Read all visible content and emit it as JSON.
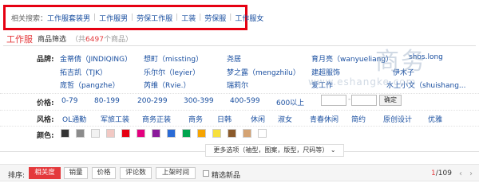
{
  "related": {
    "label": "相关搜索：",
    "links": [
      "工作服套装男",
      "工作服男",
      "劳保工作服",
      "工装",
      "劳保服",
      "工作服女"
    ]
  },
  "watermark": {
    "logo": "商务",
    "url": "www.eshangke.com"
  },
  "header": {
    "title": "工作服",
    "subtitle": "商品筛选",
    "count_prefix": "（共",
    "count": "6497",
    "count_suffix": "个商品）"
  },
  "brands": {
    "label": "品牌:",
    "items": [
      "金蒂倩（JINDIQING）",
      "想町（missting）",
      "尧居",
      "育月亮（wanyueliang）",
      "shos.long",
      "拓吉凯（TJK）",
      "乐尔尔（leyier）",
      "梦之露（mengzhilu）",
      "建超服饰",
      "伊木子",
      "庞哲（pangzhe）",
      "芮维（Rvie.）",
      "瑞莉尔",
      "爱工作",
      "水上小文（shuishang..."
    ]
  },
  "price": {
    "label": "价格:",
    "ranges": [
      "0-79",
      "80-199",
      "200-299",
      "300-399",
      "400-599",
      "600以上"
    ],
    "min_placeholder": "",
    "max_placeholder": "",
    "dash": "-",
    "confirm": "确定"
  },
  "style": {
    "label": "风格:",
    "items": [
      "OL通勤",
      "军旅工装",
      "商务正装",
      "商务",
      "日韩",
      "休闲",
      "淑女",
      "青春休闲",
      "简约",
      "原创设计",
      "优雅"
    ]
  },
  "color": {
    "label": "颜色:",
    "swatches": [
      "#333333",
      "#8c8c8c",
      "#f2f2f2",
      "#f2c9c4",
      "#e60012",
      "#e4007f",
      "#8b1a9b",
      "#2a6bd6",
      "#00a54f",
      "#f6a400",
      "#f7e03c",
      "#8b5a2b",
      "#d4a373",
      "#ffffff"
    ]
  },
  "more": {
    "label": "更多选项（袖型，图案，版型，尺码等）",
    "icon": "chevron-down-icon"
  },
  "sort": {
    "label": "排序:",
    "buttons": [
      "相关度",
      "销量",
      "价格",
      "评论数",
      "上架时间"
    ],
    "active": "相关度",
    "filter_label": "精选新品",
    "page_current": "1",
    "page_total": "/109",
    "prev": "‹",
    "next": "›"
  }
}
